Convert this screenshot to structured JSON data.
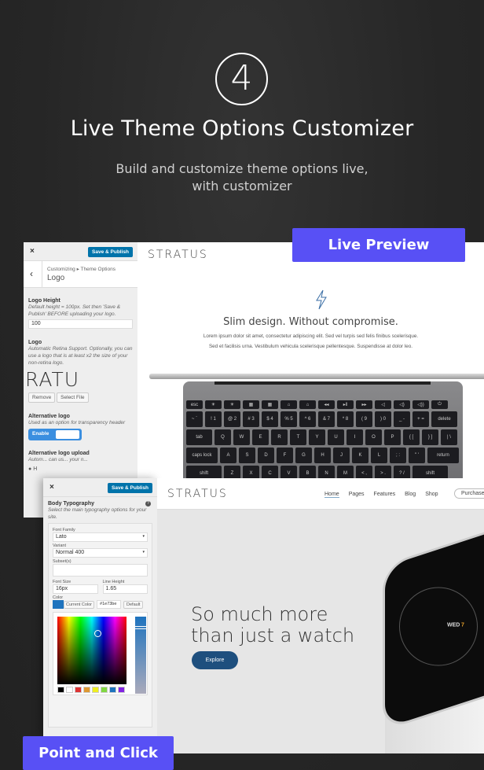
{
  "header": {
    "step": "4",
    "title": "Live Theme Options Customizer",
    "subtitle_line1": "Build and customize theme options live,",
    "subtitle_line2": "with customizer"
  },
  "badges": {
    "live_preview": "Live Preview",
    "point_and_click": "Point and Click"
  },
  "colors": {
    "accent": "#5850f5",
    "wp_blue": "#0073aa",
    "explore": "#1e4f7e",
    "background": "#262626"
  },
  "back_panel": {
    "close": "×",
    "save_publish": "Save & Publish",
    "breadcrumb": "Customizing ▸ Theme Options",
    "section": "Logo",
    "logo_height": {
      "label": "Logo Height",
      "desc": "Default height = 100px. Set then 'Save & Publish' BEFORE uploading your logo.",
      "value": "100"
    },
    "logo": {
      "label": "Logo",
      "desc": "Automatic Retina Support. Optionally, you can use a logo that is at least x2 the size of your non-retina logo.",
      "preview": "RATU",
      "remove": "Remove",
      "select": "Select File"
    },
    "alt_logo": {
      "label": "Alternative logo",
      "desc": "Used as an option for transparency header",
      "toggle": "Enable"
    },
    "alt_upload": {
      "label": "Alternative logo upload",
      "desc": "Autom... can us... your n..."
    },
    "footer_item": "H",
    "preview": {
      "brand": "STRATUS",
      "heading": "Slim design. Without compromise.",
      "body_line1": "Lorem ipsum dolor sit amet, consectetur adipiscing elit. Sed vel turpis sed felis finibus scelerisque.",
      "body_line2": "Sed et facilisis urna. Vestibulum vehicula scelerisque pellentesque. Suspendisse at dolor leo.",
      "icon": "lightning-icon"
    },
    "keyboard": [
      [
        "esc",
        "☀",
        "☀",
        "▦",
        "▦",
        "⌂",
        "⌂",
        "◂◂",
        "▸‖",
        "▸▸",
        "◁",
        "◁)",
        "◁))",
        "⏻"
      ],
      [
        "~ `",
        "! 1",
        "@ 2",
        "# 3",
        "$ 4",
        "% 5",
        "^ 6",
        "& 7",
        "* 8",
        "( 9",
        ") 0",
        "_ -",
        "+ =",
        "delete"
      ],
      [
        "tab",
        "Q",
        "W",
        "E",
        "R",
        "T",
        "Y",
        "U",
        "I",
        "O",
        "P",
        "{ [",
        "} ]",
        "| \\"
      ],
      [
        "caps lock",
        "A",
        "S",
        "D",
        "F",
        "G",
        "H",
        "J",
        "K",
        "L",
        "; :",
        "\" '",
        "return"
      ],
      [
        "shift",
        "Z",
        "X",
        "C",
        "V",
        "B",
        "N",
        "M",
        "< ,",
        "> .",
        "? /",
        "shift"
      ]
    ]
  },
  "front_panel": {
    "close": "×",
    "save_publish": "Save & Publish",
    "section_title": "Body Typography",
    "section_desc": "Select the main typography options for your site.",
    "help": "?",
    "font_family": {
      "label": "Font Family",
      "value": "Lato"
    },
    "variant": {
      "label": "Variant",
      "value": "Normal 400"
    },
    "subsets": {
      "label": "Subset(s)",
      "value": ""
    },
    "font_size": {
      "label": "Font Size",
      "value": "16px"
    },
    "line_height": {
      "label": "Line Height",
      "value": "1.65"
    },
    "color": {
      "label": "Color",
      "current": "Current Color",
      "hex": "#1e73be",
      "default": "Default",
      "swatches": [
        "#000000",
        "#ffffff",
        "#dd3333",
        "#dd9933",
        "#eeee22",
        "#81d742",
        "#1e73be",
        "#8224e3"
      ]
    },
    "preview": {
      "brand": "STRATUS",
      "nav": [
        "Home",
        "Pages",
        "Features",
        "Blog",
        "Shop"
      ],
      "purchase": "Purchase",
      "hero_line1": "So much more",
      "hero_line2": "than just a watch",
      "explore": "Explore",
      "watch_day": "WED",
      "watch_date": "7"
    }
  }
}
